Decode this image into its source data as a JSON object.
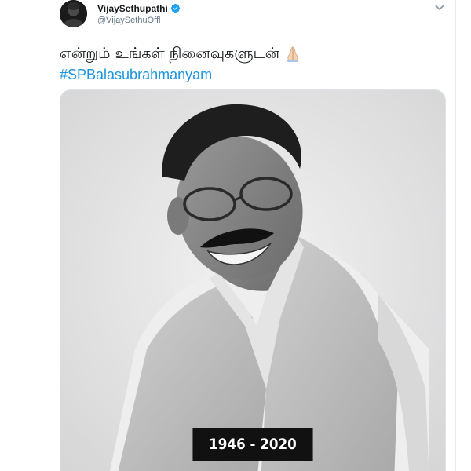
{
  "author": {
    "display_name": "VijaySethupathi",
    "handle": "@VijaySethuOffl",
    "verified_icon": "verified-badge-icon",
    "accent_color": "#1da1f2"
  },
  "tweet": {
    "text": "என்றும் உங்கள் நினைவுகளுடன்",
    "emoji_icon": "folded-hands-icon",
    "hashtag": "#SPBalasubrahmanyam",
    "hashtag_color": "#1b95e0"
  },
  "media": {
    "years_label": "1946 - 2020"
  },
  "menu": {
    "caret_icon": "chevron-down-icon"
  }
}
